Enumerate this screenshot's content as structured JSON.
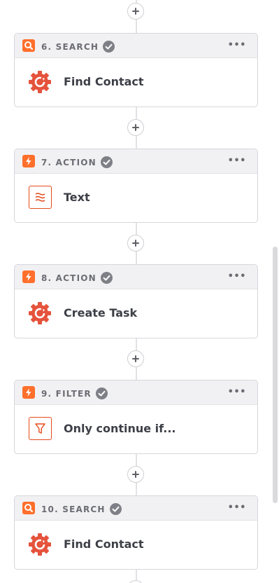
{
  "colors": {
    "accent": "#ff6f2c",
    "app_icon": "#e5533c",
    "header_bg": "#f1f1f3",
    "border": "#d7d7dc"
  },
  "steps": [
    {
      "label": "6. SEARCH",
      "type_icon": "search-icon",
      "app_icon": "gear-refresh-icon",
      "title": "Find Contact",
      "status_icon": "check-icon"
    },
    {
      "label": "7. ACTION",
      "type_icon": "lightning-icon",
      "app_icon": "text-formatter-icon",
      "title": "Text",
      "status_icon": "check-icon"
    },
    {
      "label": "8. ACTION",
      "type_icon": "lightning-icon",
      "app_icon": "gear-refresh-icon",
      "title": "Create Task",
      "status_icon": "check-icon"
    },
    {
      "label": "9. FILTER",
      "type_icon": "lightning-icon",
      "app_icon": "filter-icon",
      "title": "Only continue if...",
      "status_icon": "check-icon"
    },
    {
      "label": "10. SEARCH",
      "type_icon": "search-icon",
      "app_icon": "gear-refresh-icon",
      "title": "Find Contact",
      "status_icon": "check-icon"
    }
  ],
  "more_icon": "more-options-icon",
  "add_icon": "plus-icon"
}
